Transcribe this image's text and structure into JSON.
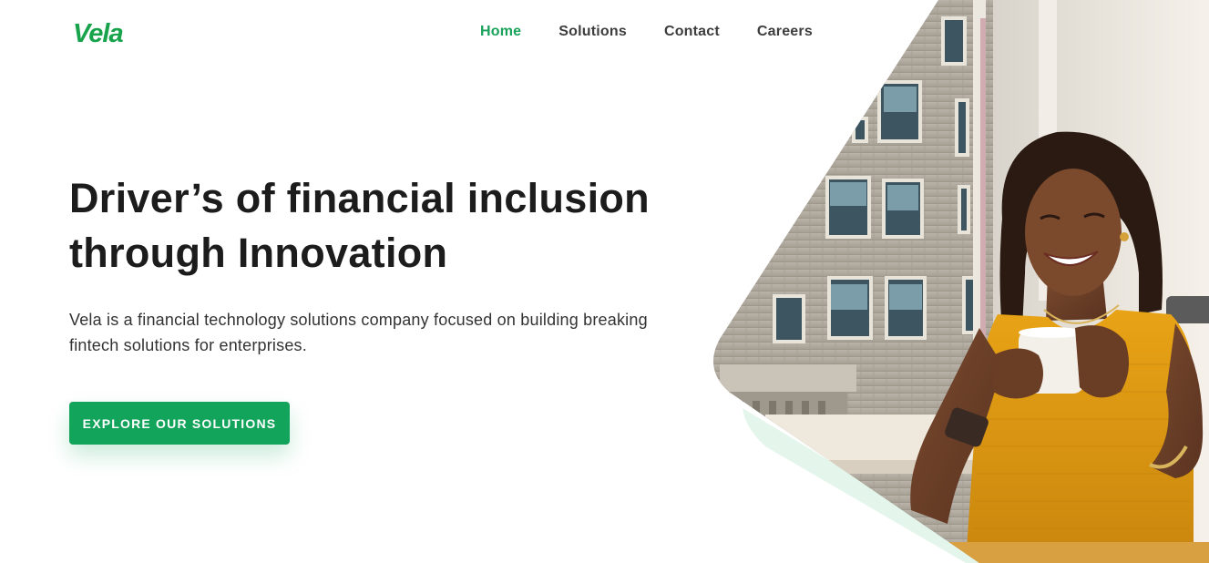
{
  "brand": {
    "name": "Vela",
    "accent_color": "#13a45c"
  },
  "nav": {
    "items": [
      {
        "label": "Home",
        "active": true
      },
      {
        "label": "Solutions",
        "active": false
      },
      {
        "label": "Contact",
        "active": false
      },
      {
        "label": "Careers",
        "active": false
      }
    ]
  },
  "hero": {
    "title_line1": "Driver’s of financial inclusion",
    "title_line2": "through Innovation",
    "description_line1": "Vela is a financial technology solutions company focused on building breaking",
    "description_line2": "fintech solutions for enterprises.",
    "cta_label": "EXPLORE OUR SOLUTIONS"
  },
  "image": {
    "subject": "smiling woman in yellow top holding a white coffee mug by a window"
  }
}
